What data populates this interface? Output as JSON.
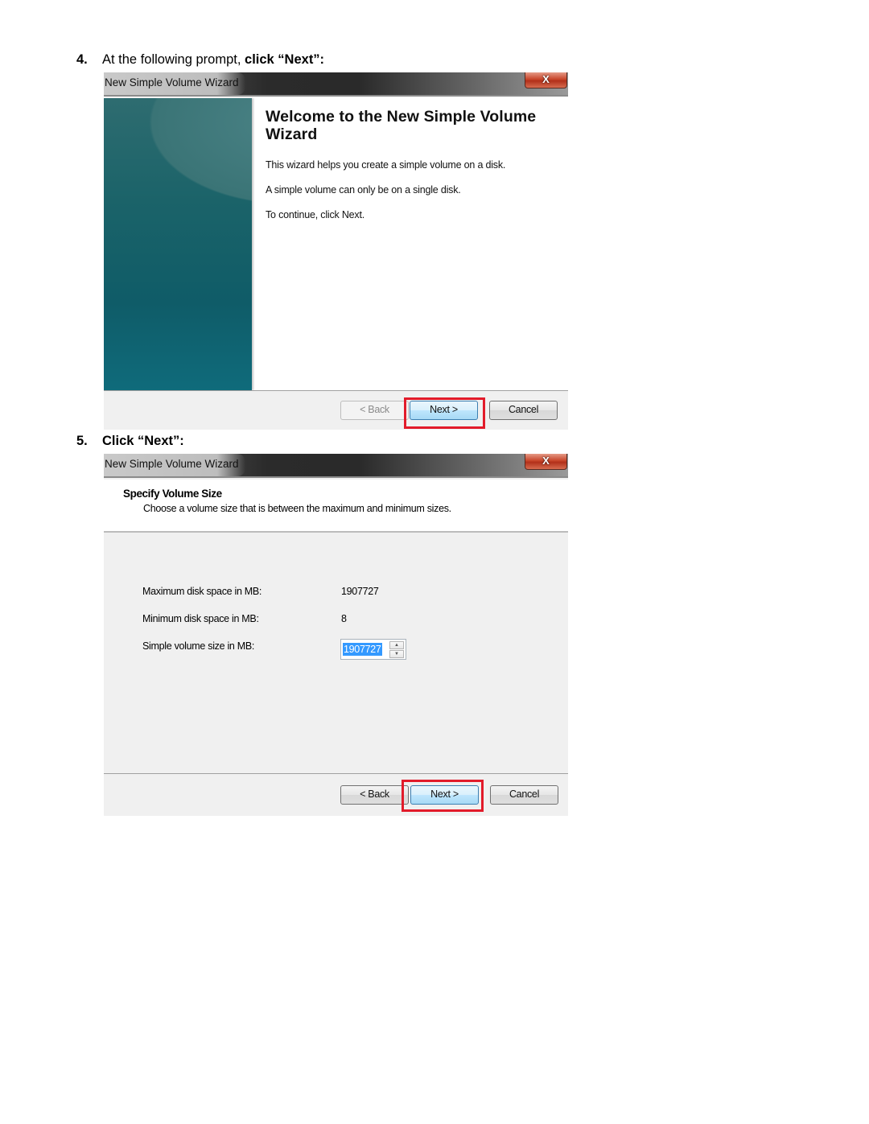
{
  "steps": [
    {
      "number": "4.",
      "text_prefix": "At the following prompt, ",
      "text_bold": "click “Next”:"
    },
    {
      "number": "5.",
      "text_prefix": "",
      "text_bold": "Click “Next”:"
    }
  ],
  "dialog1": {
    "title": "New Simple Volume Wizard",
    "close_label": "X",
    "heading": "Welcome to the New Simple Volume Wizard",
    "paragraphs": [
      "This wizard helps you create a simple volume on a disk.",
      "A simple volume can only be on a single disk.",
      "To continue, click Next."
    ],
    "buttons": {
      "back": "< Back",
      "next": "Next >",
      "cancel": "Cancel"
    },
    "back_enabled": false,
    "highlighted_button": "next"
  },
  "dialog2": {
    "title": "New Simple Volume Wizard",
    "close_label": "X",
    "header_title": "Specify Volume Size",
    "header_subtitle": "Choose a volume size that is between the maximum and minimum sizes.",
    "fields": {
      "max_label": "Maximum disk space in MB:",
      "max_value": "1907727",
      "min_label": "Minimum disk space in MB:",
      "min_value": "8",
      "size_label": "Simple volume size in MB:",
      "size_value": "1907727"
    },
    "spinner_icons": {
      "up": "▲",
      "down": "▼"
    },
    "buttons": {
      "back": "< Back",
      "next": "Next >",
      "cancel": "Cancel"
    },
    "highlighted_button": "next"
  },
  "colors": {
    "highlight": "#e21b2a",
    "selection": "#3399ff",
    "banner": "#0f5c68"
  }
}
